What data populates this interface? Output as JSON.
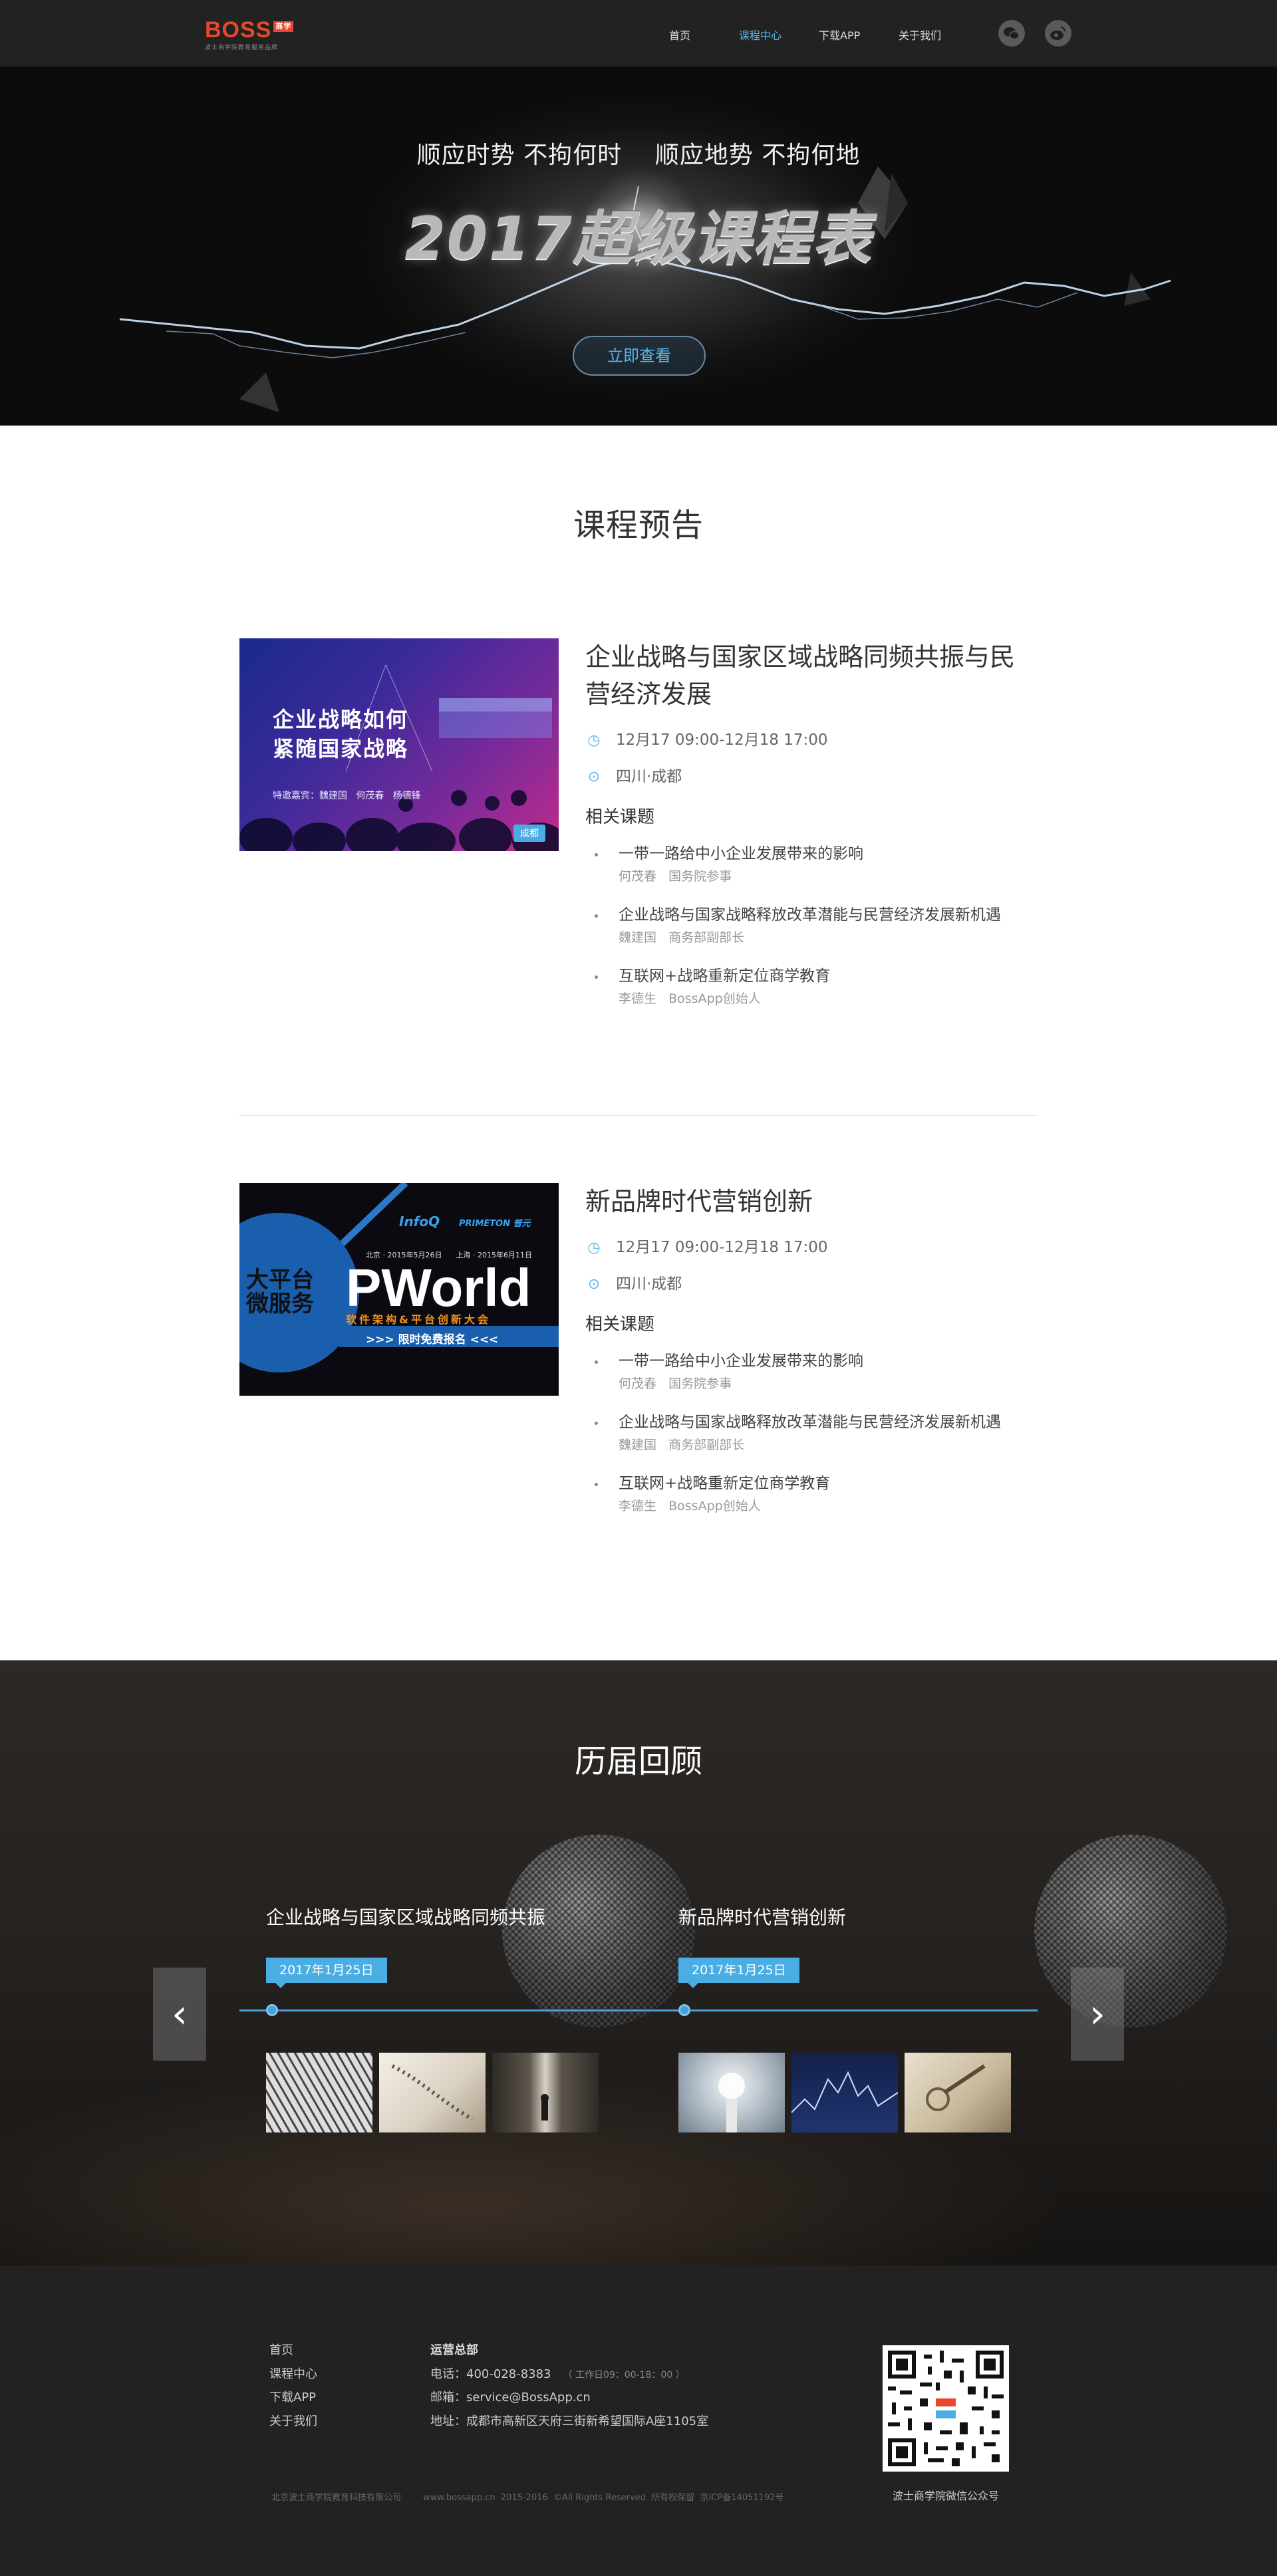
{
  "nav": {
    "logo": {
      "brand": "BOSS",
      "tag": "商学",
      "slogan": "波士商学院教育服务品牌"
    },
    "items": [
      {
        "label": "首页",
        "active": false
      },
      {
        "label": "课程中心",
        "active": true
      },
      {
        "label": "下载APP",
        "active": false
      },
      {
        "label": "关于我们",
        "active": false
      }
    ],
    "icons": [
      "wechat-icon",
      "weibo-icon"
    ]
  },
  "banner": {
    "subtitle": "顺应时势 不拘何时    顺应地势 不拘何地",
    "headline": "2017超级课程表",
    "cta": "立即查看"
  },
  "preview": {
    "title": "课程预告",
    "courses": [
      {
        "title": "企业战略与国家区域战略同频共振与民营经济发展",
        "time": "12月17 09:00-12月18 17:00",
        "location": "四川·成都",
        "related_label": "相关课题",
        "image": {
          "line1": "企业战略如何",
          "line2": "紧随国家战略",
          "guests": "特邀嘉宾：魏建国   何茂春   杨德锋",
          "city": "成都"
        },
        "topics": [
          {
            "title": "一带一路给中小企业发展带来的影响",
            "speaker": "何茂春   国务院参事"
          },
          {
            "title": "企业战略与国家战略释放改革潜能与民营经济发展新机遇",
            "speaker": "魏建国   商务部副部长"
          },
          {
            "title": "互联网+战略重新定位商学教育",
            "speaker": "李德生   BossApp创始人"
          }
        ]
      },
      {
        "title": "新品牌时代营销创新",
        "time": "12月17 09:00-12月18 17:00",
        "location": "四川·成都",
        "related_label": "相关课题",
        "image": {
          "circle_text": "大平台微服务",
          "brand_a": "InfoQ",
          "brand_b": "PRIMETON 普元",
          "dates": "北京 · 2015年5月26日      上海 · 2015年6月11日",
          "word": "PWorld",
          "subline": "软件架构&平台创新大会",
          "banner": ">>> 限时免费报名 <<<"
        },
        "topics": [
          {
            "title": "一带一路给中小企业发展带来的影响",
            "speaker": "何茂春   国务院参事"
          },
          {
            "title": "企业战略与国家战略释放改革潜能与民营经济发展新机遇",
            "speaker": "魏建国   商务部副部长"
          },
          {
            "title": "互联网+战略重新定位商学教育",
            "speaker": "李德生   BossApp创始人"
          }
        ]
      }
    ]
  },
  "review": {
    "title": "历届回顾",
    "items": [
      {
        "name": "企业战略与国家区域战略同频共振",
        "date": "2017年1月25日"
      },
      {
        "name": "新品牌时代营销创新",
        "date": "2017年1月25日"
      }
    ]
  },
  "footer": {
    "links": [
      "首页",
      "课程中心",
      "下载APP",
      "关于我们"
    ],
    "hq_label": "运营总部",
    "phone": "电话：400-028-8383",
    "hours": "（ 工作日09：00-18：00 ）",
    "email": "邮箱：service@BossApp.cn",
    "address": "地址：成都市高新区天府三街新希望国际A座1105室",
    "qr_label": "波士商学院微信公众号",
    "copyright": "北京波士商学院教育科技有限公司        www.bossapp.cn  2015-2016  ©All Rights Reserved  所有权保留  京ICP备14051192号"
  },
  "colors": {
    "accent": "#57b6e8",
    "timeline": "#4aaee3",
    "nav_bg": "#222222",
    "footer_bg": "#222222"
  }
}
